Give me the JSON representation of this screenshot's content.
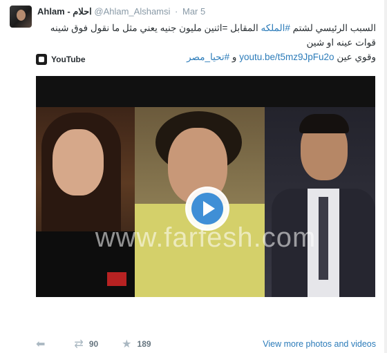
{
  "header": {
    "fullname": "Ahlam - احلام",
    "handle": "@Ahlam_Alshamsi",
    "separator": "·",
    "time": "Mar 5"
  },
  "tweet": {
    "text_line1": "السبب الرئيسي لشتم",
    "hashtag1": "#الملكه",
    "text_line1b": "المقابل =اثنين مليون جنيه يعني مثل ما نقول فوق شينه قوات عينه او شين",
    "text_line2": "وقوي عين",
    "link": "youtu.be/t5mz9JpFu2o",
    "conj": "و",
    "hashtag2": "#تحيا_مصر"
  },
  "card": {
    "source": "YouTube",
    "watermark": "www.farfesh.com"
  },
  "actions": {
    "reply_icon": "reply-icon",
    "retweet_icon": "retweet-icon",
    "retweet_count": "90",
    "favorite_icon": "star-icon",
    "favorite_count": "189",
    "more_link": "View more photos and videos"
  },
  "colors": {
    "link": "#2b7bb9",
    "play_button": "#3f8fd6"
  }
}
